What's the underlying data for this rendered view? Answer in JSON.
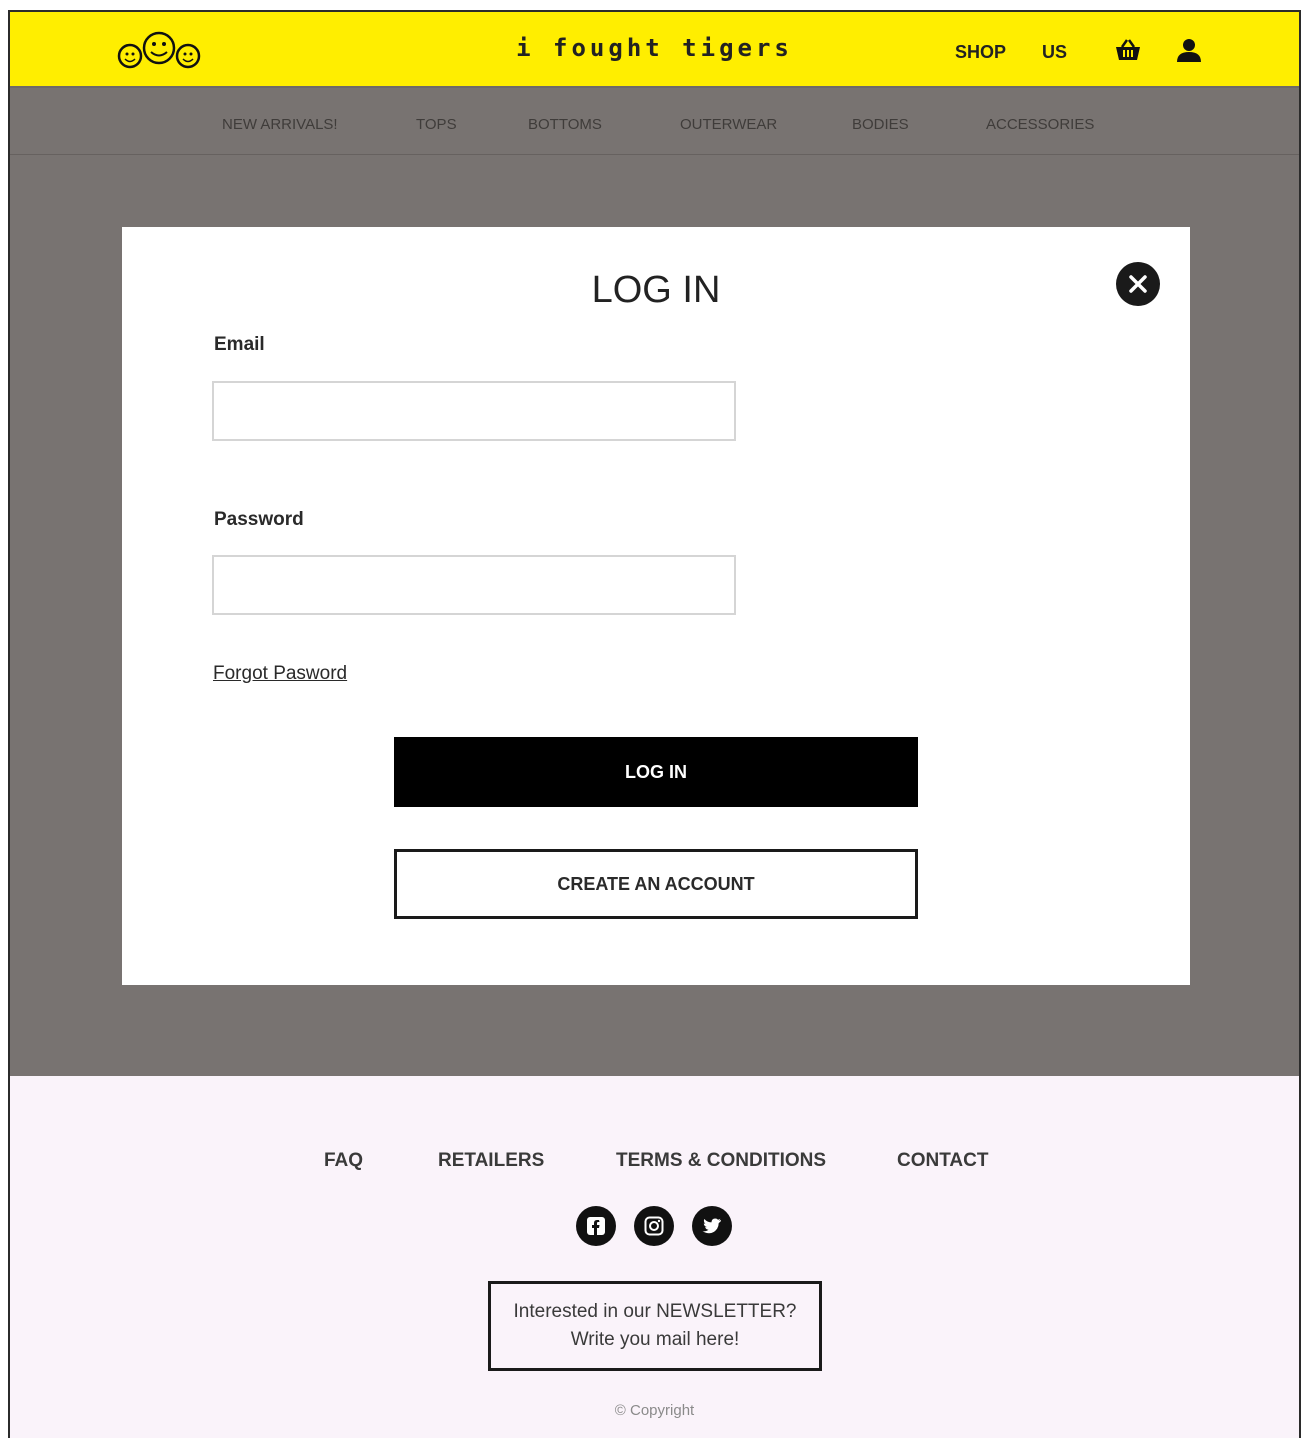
{
  "header": {
    "brand": "i fought tigers",
    "nav": {
      "shop": "SHOP",
      "us": "US"
    },
    "icons": {
      "logo": "smiley-faces-logo",
      "cart": "basket-icon",
      "account": "user-icon"
    },
    "background_color": "#ffee00"
  },
  "categories": [
    "NEW ARRIVALS!",
    "TOPS",
    "BOTTOMS",
    "OUTERWEAR",
    "BODIES",
    "ACCESSORIES"
  ],
  "login_modal": {
    "title": "LOG IN",
    "email_label": "Email",
    "email_value": "",
    "password_label": "Password",
    "password_value": "",
    "forgot_link": "Forgot Pasword",
    "login_button": "LOG IN",
    "create_button": "CREATE AN ACCOUNT",
    "close_icon": "close-icon"
  },
  "footer": {
    "links": [
      "FAQ",
      "RETAILERS",
      "TERMS & CONDITIONS",
      "CONTACT"
    ],
    "social": [
      "facebook-icon",
      "instagram-icon",
      "twitter-icon"
    ],
    "newsletter": {
      "line1": "Interested in our NEWSLETTER?",
      "line2": "Write you mail here!"
    },
    "copyright": "© Copyright",
    "background_color": "#faf3fa"
  },
  "overlay_color": "#787371"
}
